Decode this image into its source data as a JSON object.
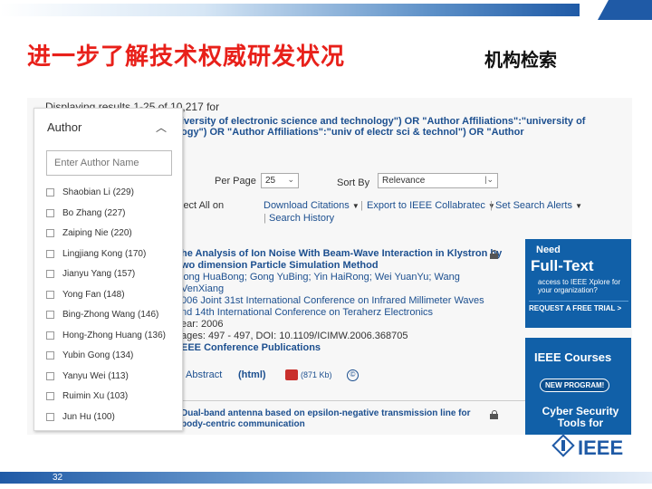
{
  "slide": {
    "title": "进一步了解技术权威研发状况",
    "subtitle": "机构检索",
    "page_number": "32"
  },
  "results": {
    "displaying": "Displaying results 1-25 of 10,217 for",
    "query_line1": "iversity of electronic science and technology\") OR \"Author Affiliations\":\"university of",
    "query_line2": "ogy\") OR \"Author Affiliations\":\"univ of electr sci & technol\") OR \"Author"
  },
  "controls": {
    "per_page_label": "Per Page",
    "per_page_value": "25",
    "sort_by_label": "Sort By",
    "sort_by_value": "Relevance"
  },
  "actions": {
    "select_all": "lect All on",
    "download": "Download Citations",
    "export": "Export to IEEE Collabratec",
    "alerts": "Set Search Alerts",
    "history": "Search History"
  },
  "result1": {
    "title1": "he Analysis of Ion Noise With Beam-Wave Interaction in Klystron by",
    "title2": "wo dimension Particle Simulation Method",
    "authors1": "iong HuaBong; Gong YuBing; Yin HaiRong; Wei YuanYu; Wang",
    "authors2": "VenXiang",
    "conf1": "006 Joint 31st International Conference on Infrared Millimeter Waves",
    "conf2": "nd 14th International Conference on Teraherz Electronics",
    "year": "ear: 2006",
    "pages": "ages: 497 - 497, DOI: 10.1109/ICIMW.2006.368705",
    "publisher": "EEE Conference Publications",
    "abstract": "Abstract",
    "html": "(html)",
    "pdf_size": "(871 Kb)",
    "copyright": "©"
  },
  "result2": {
    "title1": "Dual-band antenna based on epsilon-negative transmission line for",
    "title2": "body-centric communication"
  },
  "ads": {
    "ad1_need": "Need",
    "ad1_fulltext": "Full-Text",
    "ad1_access": "access to IEEE Xplore for your organization?",
    "ad1_request": "REQUEST A FREE TRIAL >",
    "ad2_courses": "IEEE Courses",
    "ad2_program": "NEW PROGRAM!",
    "ad2_cyber": "Cyber Security Tools for"
  },
  "author_panel": {
    "heading": "Author",
    "placeholder": "Enter Author Name",
    "items": [
      "Shaobian Li (229)",
      "Bo Zhang (227)",
      "Zaiping Nie (220)",
      "Lingjiang Kong (170)",
      "Jianyu Yang (157)",
      "Yong Fan (148)",
      "Bing-Zhong Wang (146)",
      "Hong-Zhong Huang (136)",
      "Yubin Gong (134)",
      "Yanyu Wei (113)",
      "Ruimin Xu (103)",
      "Jun Hu (100)"
    ]
  },
  "logo": {
    "text": "IEEE"
  },
  "colors": {
    "title_red": "#e8201a",
    "ieee_blue": "#1f5aa6",
    "link_blue": "#1c4f8f"
  }
}
